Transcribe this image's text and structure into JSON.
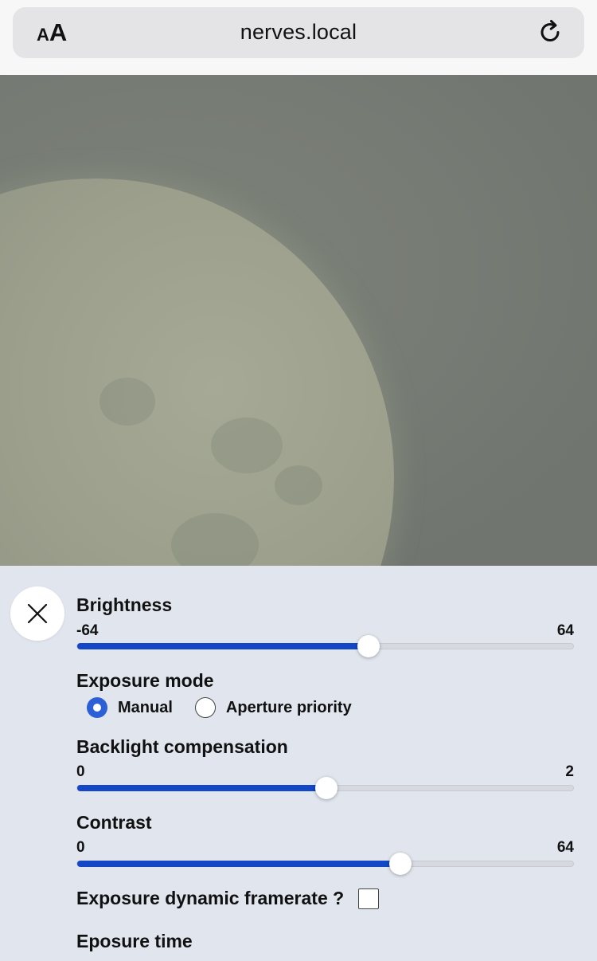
{
  "browser": {
    "text_size_button": {
      "small": "A",
      "large": "A"
    },
    "url": "nerves.local",
    "reload_icon": "reload-icon"
  },
  "camera": {
    "subject_icon": "moon-image"
  },
  "controls": {
    "close_icon": "close-icon",
    "brightness": {
      "label": "Brightness",
      "min": "-64",
      "max": "64",
      "value_fraction": 0.585
    },
    "exposure_mode": {
      "label": "Exposure mode",
      "options": [
        {
          "label": "Manual",
          "selected": true
        },
        {
          "label": "Aperture priority",
          "selected": false
        }
      ]
    },
    "backlight_compensation": {
      "label": "Backlight compensation",
      "min": "0",
      "max": "2",
      "value_fraction": 0.5
    },
    "contrast": {
      "label": "Contrast",
      "min": "0",
      "max": "64",
      "value_fraction": 0.65
    },
    "exposure_dynamic_framerate": {
      "label": "Exposure dynamic framerate ?",
      "checked": false
    },
    "exposure_time": {
      "label": "Eposure time"
    }
  },
  "colors": {
    "accent": "#1447c6",
    "panel_background": "#e1e5ee"
  }
}
